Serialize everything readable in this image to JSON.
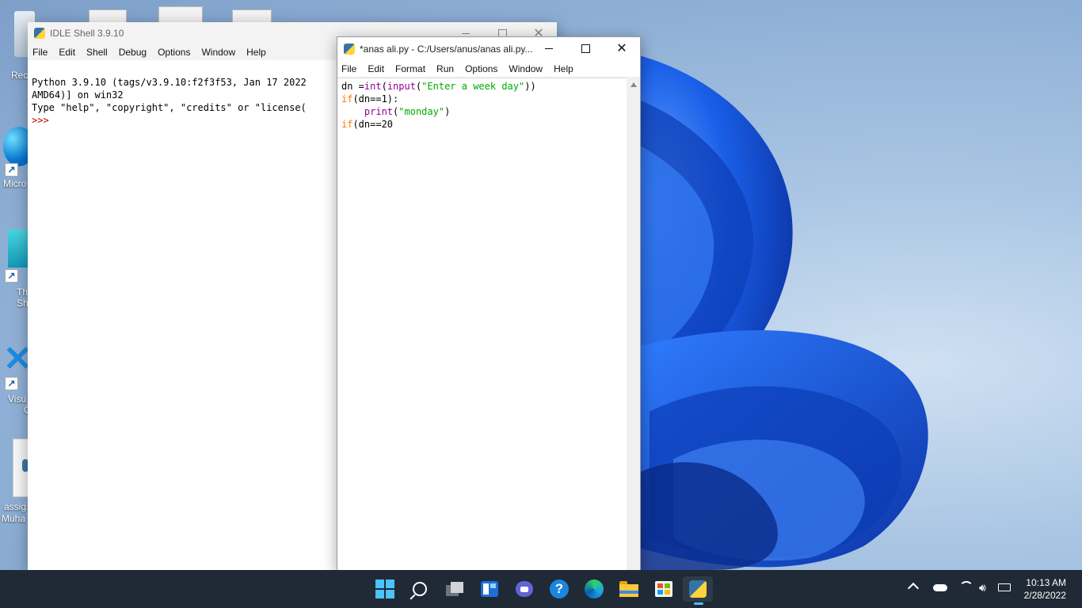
{
  "desktop": {
    "icons": [
      {
        "label": "Rec",
        "icon": "recycle-bin-icon"
      },
      {
        "label": "Micro",
        "icon": "edge-shortcut-icon"
      },
      {
        "label": "Th",
        "label2": "Sh",
        "icon": "app-shortcut-icon"
      },
      {
        "label": "Visu",
        "label2": "C",
        "icon": "vscode-icon"
      },
      {
        "label": "assig",
        "label2": "Muha",
        "icon": "document-icon"
      }
    ]
  },
  "shell": {
    "title": "IDLE Shell 3.9.10",
    "menu": [
      "File",
      "Edit",
      "Shell",
      "Debug",
      "Options",
      "Window",
      "Help"
    ],
    "lines": [
      "Python 3.9.10 (tags/v3.9.10:f2f3f53, Jan 17 2022",
      "AMD64)] on win32",
      "Type \"help\", \"copyright\", \"credits\" or \"license("
    ],
    "prompt": ">>>"
  },
  "editor": {
    "title": "*anas ali.py - C:/Users/anus/anas ali.py...",
    "menu": [
      "File",
      "Edit",
      "Format",
      "Run",
      "Options",
      "Window",
      "Help"
    ],
    "code": {
      "l1_a": "dn =",
      "l1_b": "int",
      "l1_c": "(",
      "l1_d": "input",
      "l1_e": "(",
      "l1_f": "\"Enter a week day\"",
      "l1_g": "))",
      "l2_a": "if",
      "l2_b": "(dn==1):",
      "l3_indent": "    ",
      "l3_a": "print",
      "l3_b": "(",
      "l3_c": "\"monday\"",
      "l3_d": ")",
      "l4_a": "if",
      "l4_b": "(dn==20"
    }
  },
  "taskbar": {
    "apps": [
      "start-icon",
      "search-icon",
      "task-view-icon",
      "widgets-icon",
      "chat-icon",
      "help-icon",
      "edge-icon",
      "file-explorer-icon",
      "store-icon",
      "python-idle-icon"
    ],
    "time": "10:13 AM",
    "date": "2/28/2022"
  },
  "colors": {
    "keyword": "#ff7700",
    "builtin": "#900090",
    "string": "#00aa00",
    "prompt": "#c00000",
    "taskbar": "#202a36"
  }
}
